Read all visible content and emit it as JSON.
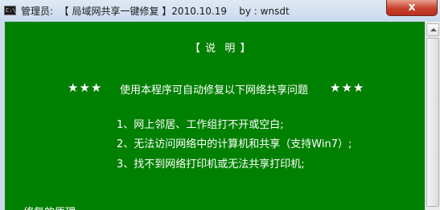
{
  "window": {
    "title": "管理员:  【 局域网共享一键修复 】2010.10.19    by : wnsdt",
    "app_icon_text": "C:\\",
    "close_label": "x"
  },
  "console": {
    "heading": "【 说  明 】",
    "stars_left": "★★★",
    "subtitle": "使用本程序可自动修复以下网络共享问题",
    "stars_right": "★★★",
    "items": [
      "1、网上邻居、工作组打不开或空白;",
      "2、无法访问网络中的计算机和共享（支持Win7）;",
      "3、找不到网络打印机或无法共享打印机;"
    ],
    "cut_line": "一 修复的原理"
  },
  "colors": {
    "console_bg": "#008000",
    "console_text": "#ffffff",
    "titlebar": "#c9daee",
    "close_button": "#c8402c"
  }
}
